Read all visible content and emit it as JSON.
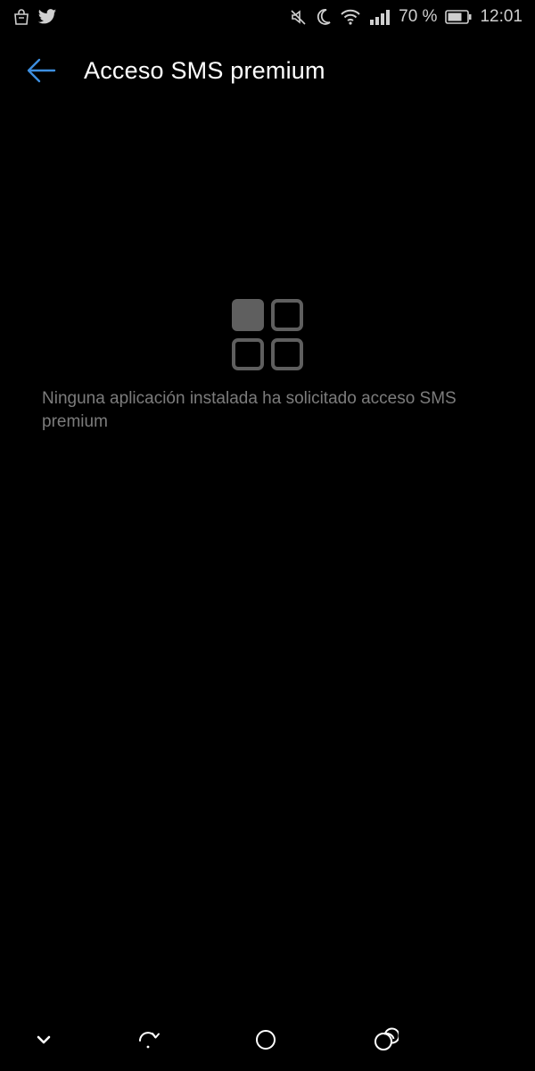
{
  "status_bar": {
    "battery_percent": "70 %",
    "time": "12:01",
    "left_icons": [
      "shopping-bag-icon",
      "twitter-icon"
    ],
    "right_icons": [
      "muted-icon",
      "moon-icon",
      "wifi-icon",
      "signal-icon",
      "battery-icon"
    ]
  },
  "app_bar": {
    "title": "Acceso SMS premium",
    "back_icon": "back-arrow-icon",
    "accent_color": "#3d8fe0"
  },
  "empty_state": {
    "icon": "apps-grid-icon",
    "message": "Ninguna aplicación instalada ha solicitado acceso SMS premium"
  },
  "nav_bar": {
    "buttons": [
      "hide-nav-icon",
      "rotate-icon",
      "home-icon",
      "recents-icon"
    ]
  }
}
